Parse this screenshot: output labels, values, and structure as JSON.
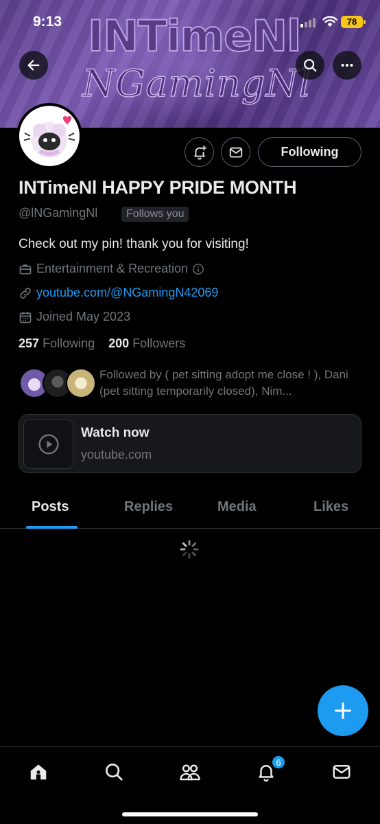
{
  "status_bar": {
    "time": "9:13",
    "battery": "78"
  },
  "banner": {
    "title": "INTimeNl",
    "subtitle": "NGamingNl"
  },
  "header": {
    "back_icon": "arrow-left-icon",
    "search_icon": "search-icon",
    "more_icon": "more-horizontal-icon"
  },
  "profile": {
    "display_name": "INTimeNl HAPPY PRIDE MONTH",
    "handle": "@lNGamingNl",
    "follows_you": "Follows you",
    "bio": "Check out my pin! thank you for visiting!",
    "category": "Entertainment & Recreation",
    "link": "youtube.com/@NGamingN42069",
    "joined": "Joined May 2023",
    "following_count": "257",
    "following_label": "Following",
    "followers_count": "200",
    "followers_label": "Followers",
    "followed_by": "Followed by ( pet sitting adopt me close ! ), Dani (pet sitting temporarily closed), Nim..."
  },
  "actions": {
    "following_button": "Following"
  },
  "link_card": {
    "title": "Watch now",
    "domain": "youtube.com"
  },
  "tabs": [
    {
      "label": "Posts",
      "active": true
    },
    {
      "label": "Replies",
      "active": false
    },
    {
      "label": "Media",
      "active": false
    },
    {
      "label": "Likes",
      "active": false
    }
  ],
  "bottom_nav": {
    "items": [
      "home-icon",
      "search-icon",
      "communities-icon",
      "notifications-icon",
      "messages-icon"
    ],
    "notification_badge": "6"
  },
  "colors": {
    "accent": "#1d9bf0",
    "battery": "#f5c518",
    "background": "#000000"
  }
}
